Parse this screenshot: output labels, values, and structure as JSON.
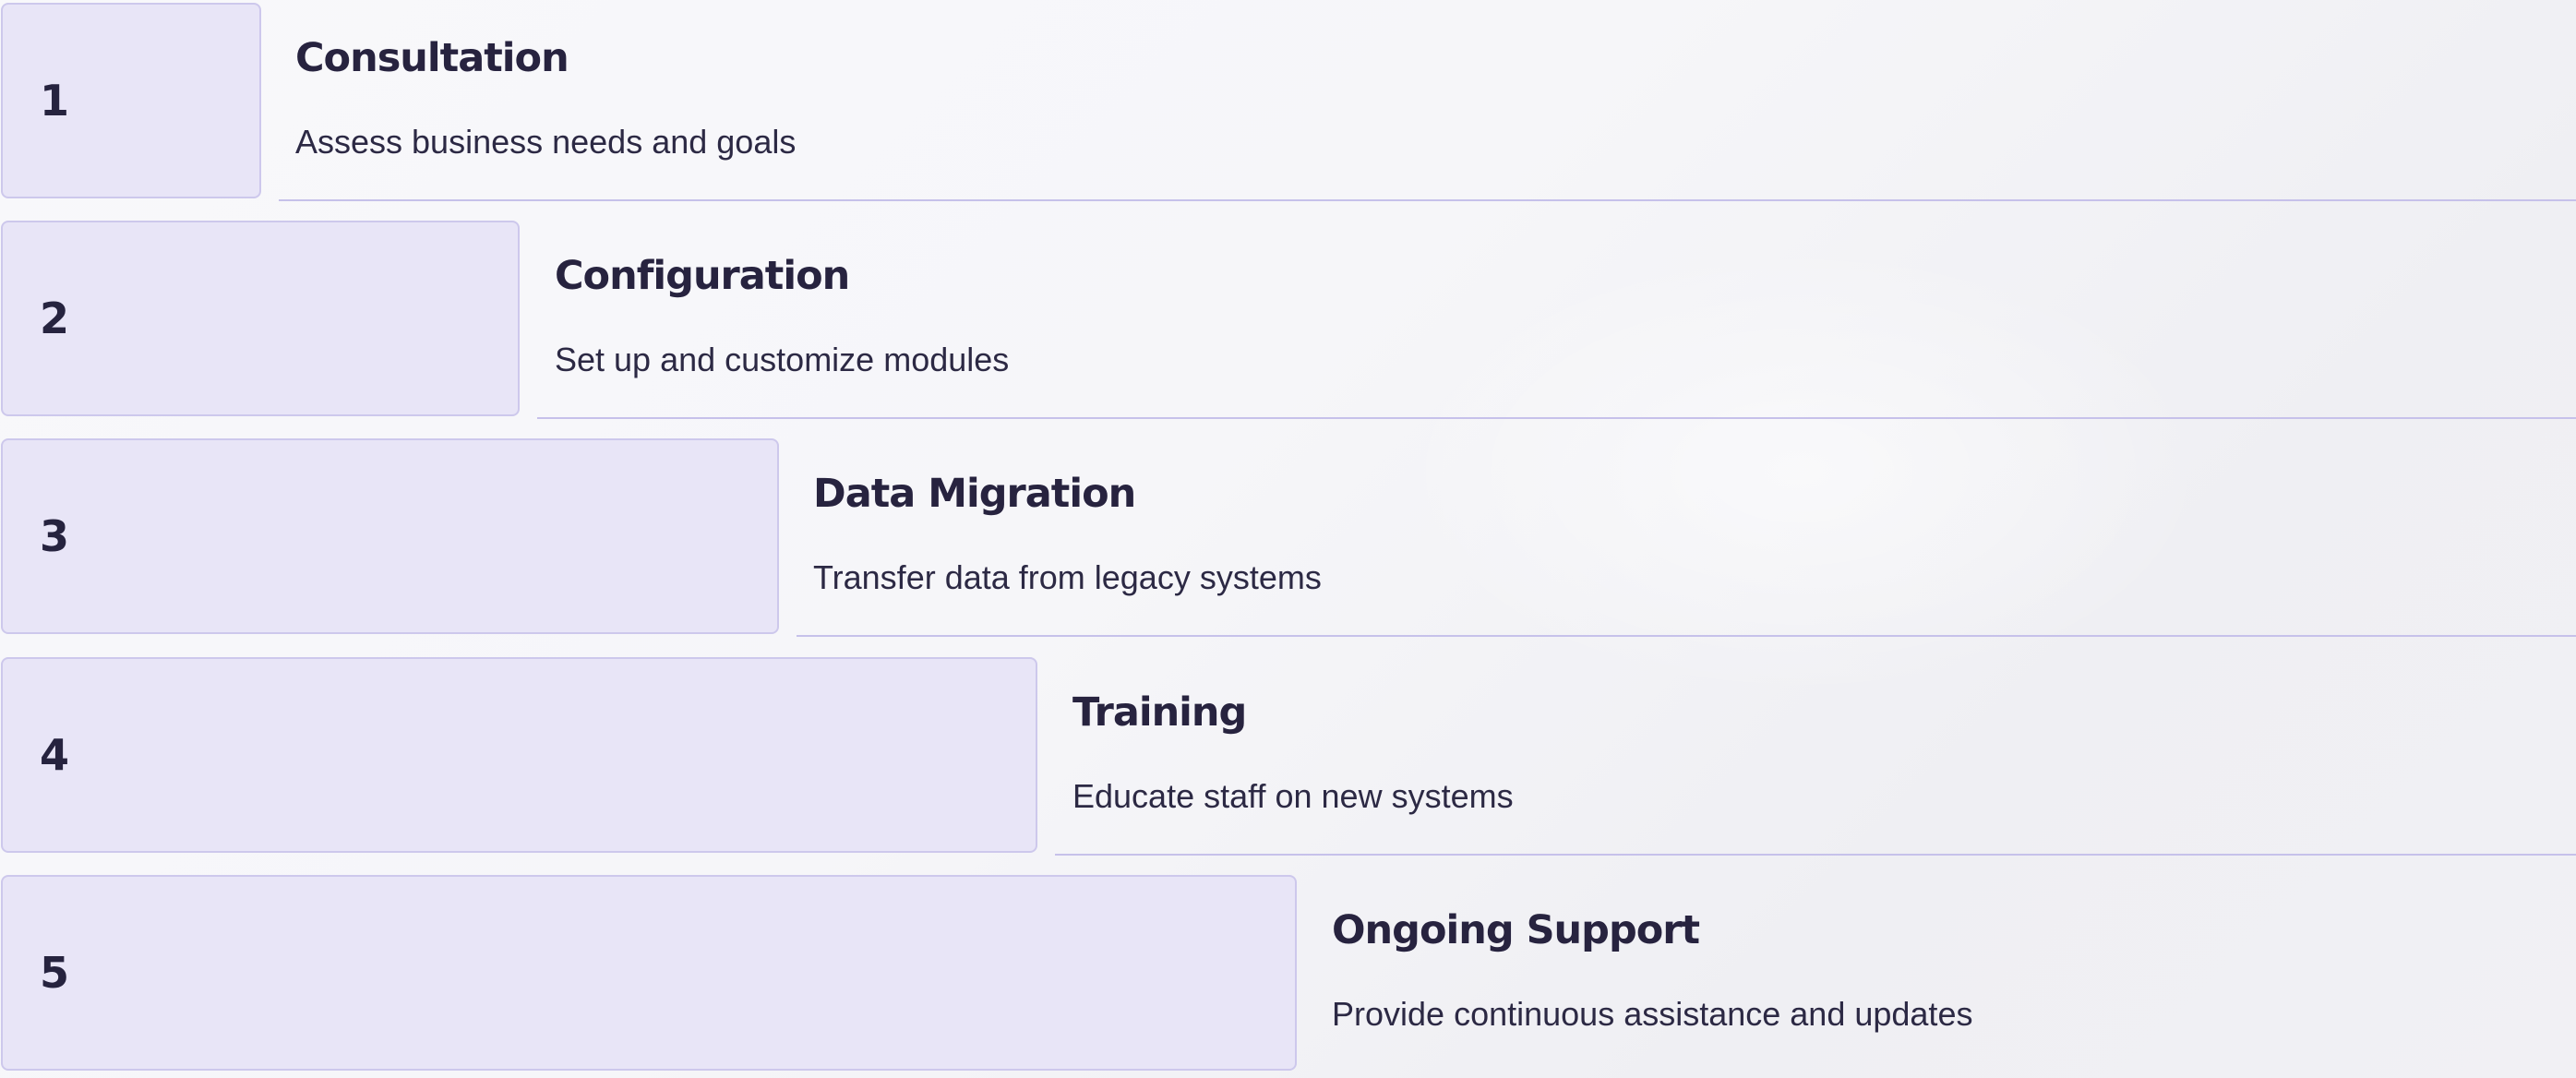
{
  "steps": [
    {
      "number": "1",
      "title": "Consultation",
      "description": "Assess business needs and goals"
    },
    {
      "number": "2",
      "title": "Configuration",
      "description": "Set up and customize modules"
    },
    {
      "number": "3",
      "title": "Data Migration",
      "description": "Transfer data from legacy systems"
    },
    {
      "number": "4",
      "title": "Training",
      "description": "Educate staff on new systems"
    },
    {
      "number": "5",
      "title": "Ongoing Support",
      "description": "Provide continuous assistance and updates"
    }
  ],
  "colors": {
    "box_fill": "#e8e5f7",
    "box_border": "#cdc8ec",
    "text": "#25223d",
    "line": "#c6c1ea"
  }
}
